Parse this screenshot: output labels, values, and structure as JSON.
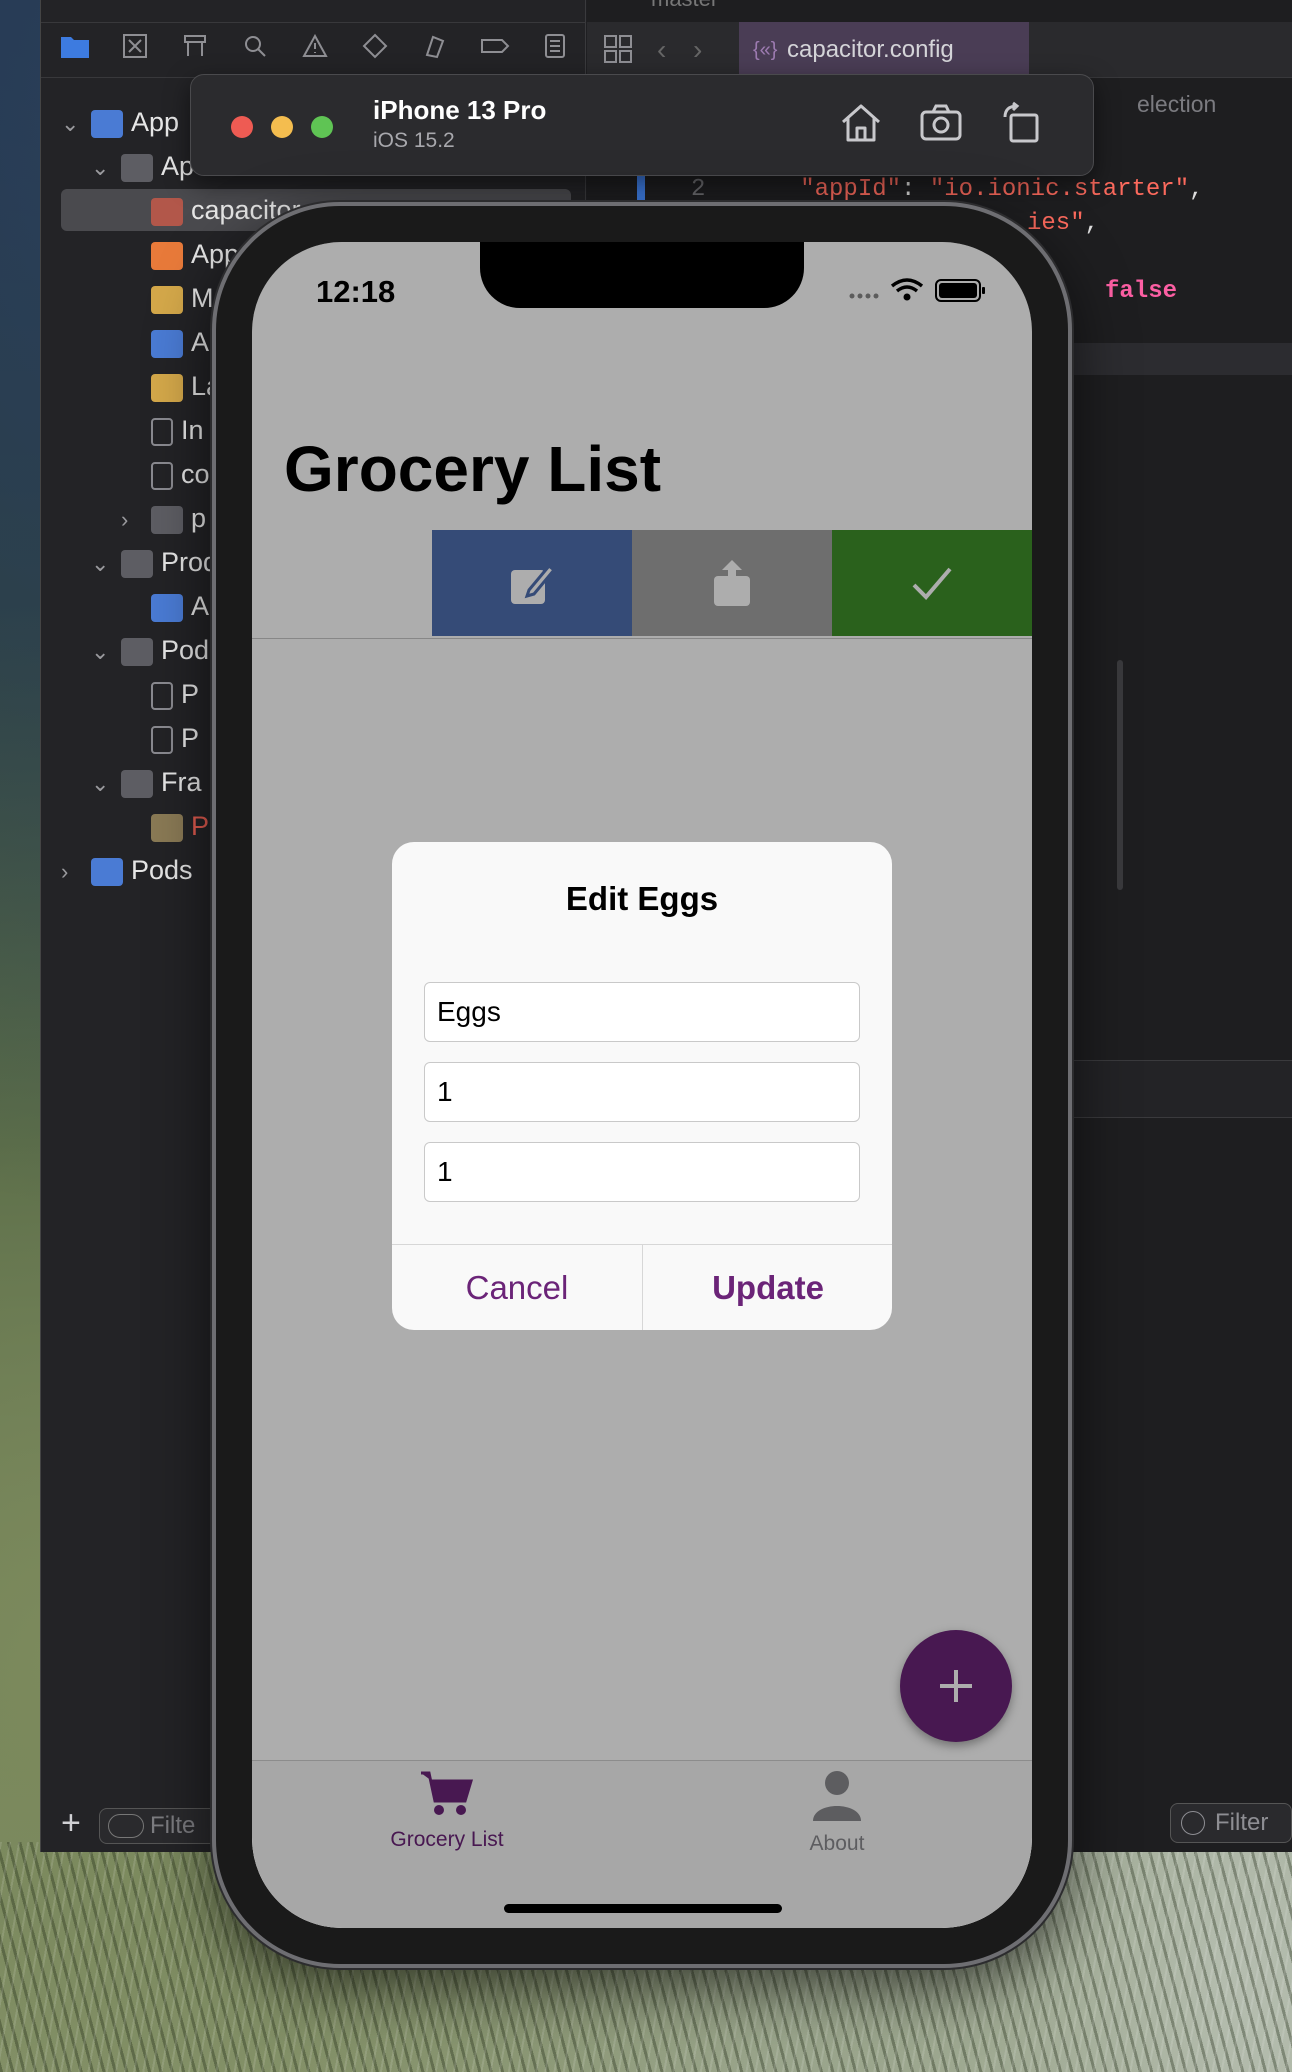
{
  "xcode": {
    "branch": "master",
    "navigator_tree": [
      {
        "label": "App",
        "depth": 0,
        "expanded": true,
        "kind": "project"
      },
      {
        "label": "Ap",
        "depth": 1,
        "expanded": true,
        "kind": "folder"
      },
      {
        "label": "capacitor",
        "depth": 2,
        "kind": "json",
        "selected": true
      },
      {
        "label": "App",
        "depth": 2,
        "kind": "swift"
      },
      {
        "label": "M",
        "depth": 2,
        "kind": "storyboard"
      },
      {
        "label": "A",
        "depth": 2,
        "kind": "assets"
      },
      {
        "label": "La",
        "depth": 2,
        "kind": "storyboard"
      },
      {
        "label": "In",
        "depth": 2,
        "kind": "plist"
      },
      {
        "label": "co",
        "depth": 2,
        "kind": "file"
      },
      {
        "label": "p",
        "depth": 2,
        "expanded": false,
        "kind": "folder"
      },
      {
        "label": "Prod",
        "depth": 1,
        "expanded": true,
        "kind": "folder"
      },
      {
        "label": "A",
        "depth": 2,
        "kind": "app"
      },
      {
        "label": "Pod",
        "depth": 1,
        "expanded": true,
        "kind": "folder"
      },
      {
        "label": "P",
        "depth": 2,
        "kind": "file"
      },
      {
        "label": "P",
        "depth": 2,
        "kind": "file"
      },
      {
        "label": "Fra",
        "depth": 1,
        "expanded": true,
        "kind": "folder"
      },
      {
        "label": "P",
        "depth": 2,
        "kind": "framework"
      },
      {
        "label": "Pods",
        "depth": 0,
        "expanded": false,
        "kind": "project"
      }
    ],
    "nav_filter_placeholder": "Filte",
    "editor_tab": "capacitor.config",
    "jump_bar_text": "election",
    "code": {
      "line_number": "2",
      "line2_key": "\"appId\"",
      "line2_colon": ": ",
      "line2_value": "\"io.ionic.starter\"",
      "line2_comma": ",",
      "line3_value": "ies\"",
      "line3_comma": ",",
      "line4_value": "false"
    },
    "editor_filter_placeholder": "Filter"
  },
  "simulator": {
    "device_name": "iPhone 13 Pro",
    "os_version": "iOS 15.2"
  },
  "app": {
    "status_time": "12:18",
    "page_title": "Grocery List",
    "swipe_actions": [
      {
        "name": "edit",
        "color": "#4f6fb0",
        "icon": "edit-icon"
      },
      {
        "name": "share",
        "color": "#a3a3a3",
        "icon": "share-icon"
      },
      {
        "name": "complete",
        "color": "#3f8f2a",
        "icon": "checkmark-icon"
      }
    ],
    "tabs": [
      {
        "label": "Grocery List",
        "icon": "cart-icon",
        "active": true
      },
      {
        "label": "About",
        "icon": "person-icon",
        "active": false
      }
    ],
    "accent_color": "#6b2478",
    "fab_icon": "plus-icon"
  },
  "dialog": {
    "title": "Edit Eggs",
    "inputs": [
      {
        "value": "Eggs"
      },
      {
        "value": "1"
      },
      {
        "value": "1"
      }
    ],
    "cancel_label": "Cancel",
    "update_label": "Update"
  }
}
